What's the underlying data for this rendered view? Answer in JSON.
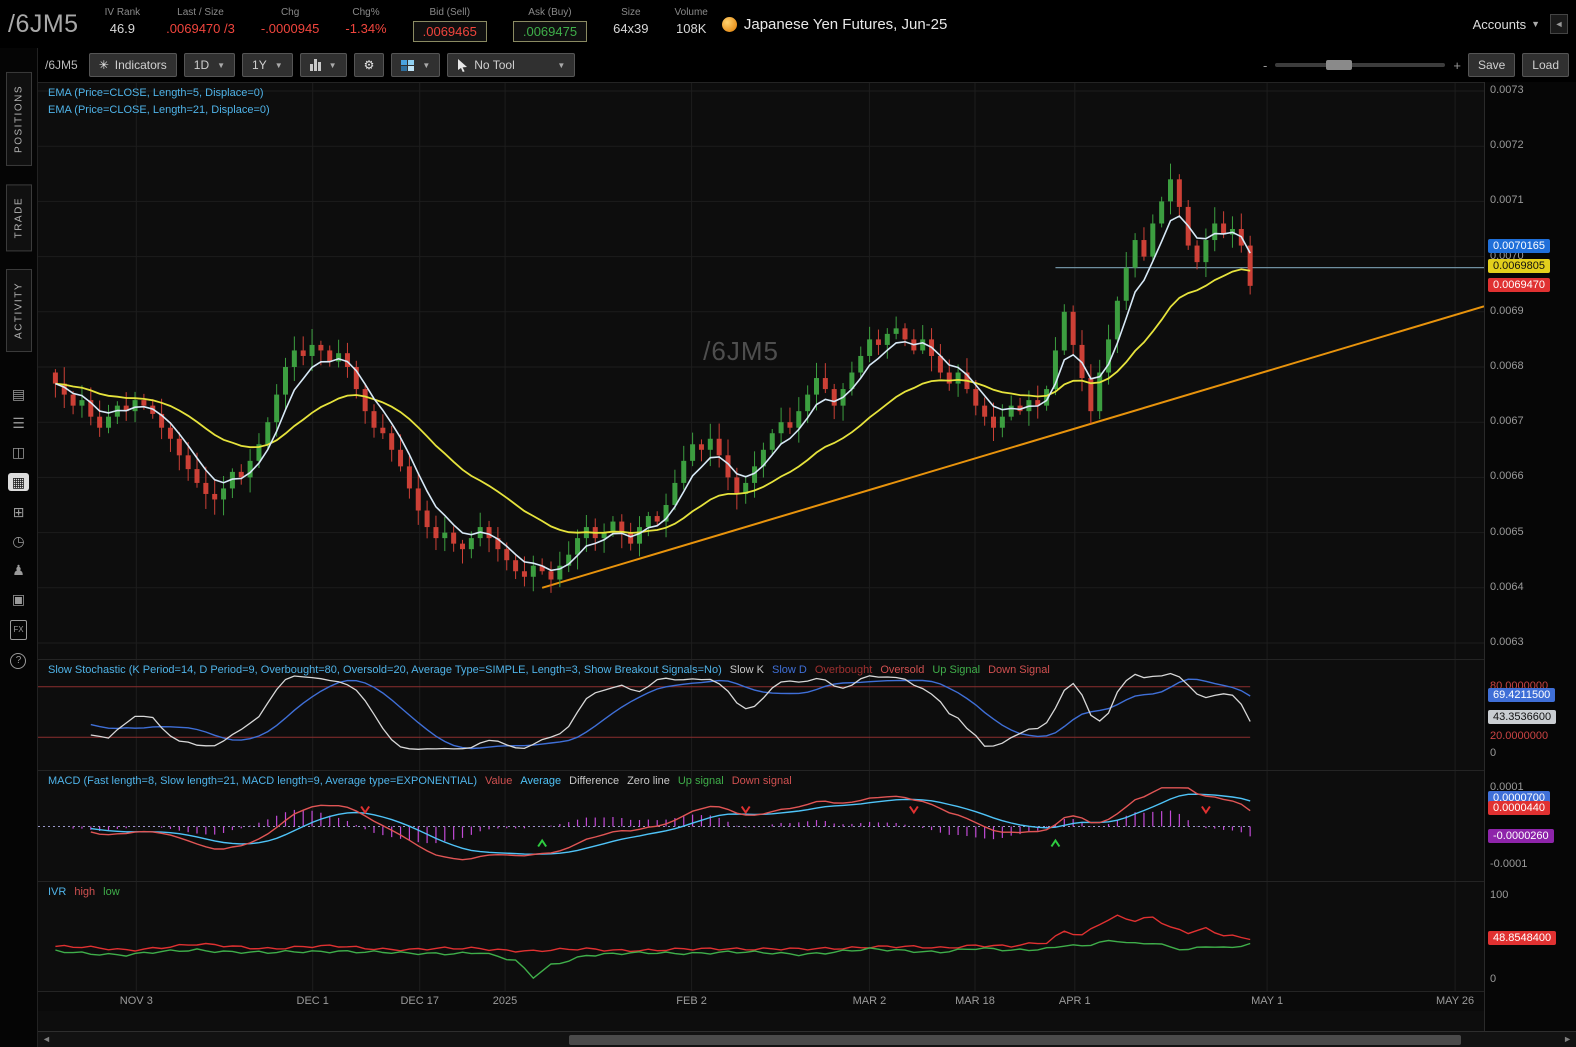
{
  "header": {
    "symbol": "/6JM5",
    "title": "Japanese Yen Futures, Jun-25",
    "accounts_label": "Accounts",
    "fields": [
      {
        "label": "IV Rank",
        "value": "46.9",
        "color": "#d8d8d8",
        "boxed": false
      },
      {
        "label": "Last / Size",
        "value": ".0069470 /3",
        "color": "#f0453d",
        "boxed": false
      },
      {
        "label": "Chg",
        "value": "-.0000945",
        "color": "#f0453d",
        "boxed": false
      },
      {
        "label": "Chg%",
        "value": "-1.34%",
        "color": "#f0453d",
        "boxed": false
      },
      {
        "label": "Bid (Sell)",
        "value": ".0069465",
        "color": "#f0453d",
        "boxed": true
      },
      {
        "label": "Ask (Buy)",
        "value": ".0069475",
        "color": "#3fae4a",
        "boxed": true
      },
      {
        "label": "Size",
        "value": "64x39",
        "color": "#d8d8d8",
        "boxed": false
      },
      {
        "label": "Volume",
        "value": "108K",
        "color": "#d8d8d8",
        "boxed": false
      }
    ]
  },
  "icons": {
    "chevron_down": "▼",
    "collapse_left": "◄",
    "gear": "⚙",
    "indicators": "✳",
    "scroll_left": "◄",
    "scroll_right": "►"
  },
  "sidebar": {
    "tabs": [
      {
        "label": "POSITIONS"
      },
      {
        "label": "TRADE"
      },
      {
        "label": "ACTIVITY"
      }
    ],
    "icons_list": [
      {
        "name": "document-icon",
        "glyph": "▤",
        "active": false
      },
      {
        "name": "list-icon",
        "glyph": "☰",
        "active": false
      },
      {
        "name": "watchlist-icon",
        "glyph": "◫",
        "active": false
      },
      {
        "name": "chart-icon",
        "glyph": "▦",
        "active": true
      },
      {
        "name": "apps-grid-icon",
        "glyph": "⊞",
        "active": false
      },
      {
        "name": "clock-icon",
        "glyph": "◷",
        "active": false
      },
      {
        "name": "people-icon",
        "glyph": "♟",
        "active": false
      },
      {
        "name": "archive-icon",
        "glyph": "▣",
        "active": false
      },
      {
        "name": "fx-icon",
        "glyph": "FX",
        "active": false,
        "fx": true
      },
      {
        "name": "help-icon",
        "glyph": "?",
        "active": false,
        "circle": true
      }
    ]
  },
  "toolbar": {
    "symbol_label": "/6JM5",
    "indicators_label": "Indicators",
    "timeframe": "1D",
    "range": "1Y",
    "tool_label": "No Tool",
    "zoom_minus": "-",
    "zoom_plus": "+",
    "save_label": "Save",
    "load_label": "Load"
  },
  "main_chart": {
    "watermark": "/6JM5"
  },
  "legends": {
    "main": [
      {
        "text": "EMA (Price=CLOSE, Length=5, Displace=0)",
        "color": "#4fb3e8"
      },
      {
        "text": "EMA (Price=CLOSE, Length=21, Displace=0)",
        "color": "#4fb3e8"
      }
    ],
    "stoch": [
      {
        "text": "Slow Stochastic (K Period=14, D Period=9, Overbought=80, Oversold=20, Average Type=SIMPLE, Length=3, Show Breakout Signals=No)",
        "color": "#4fb3e8"
      },
      {
        "text": "Slow K",
        "color": "#c8c8c8"
      },
      {
        "text": "Slow D",
        "color": "#3f6fd7"
      },
      {
        "text": "Overbought",
        "color": "#a03030"
      },
      {
        "text": "Oversold",
        "color": "#d05050"
      },
      {
        "text": "Up Signal",
        "color": "#3fae4a"
      },
      {
        "text": "Down Signal",
        "color": "#d05050"
      }
    ],
    "macd": [
      {
        "text": "MACD (Fast length=8, Slow length=21, MACD length=9, Average type=EXPONENTIAL)",
        "color": "#4fb3e8"
      },
      {
        "text": "Value",
        "color": "#d05050"
      },
      {
        "text": "Average",
        "color": "#4fc3f7"
      },
      {
        "text": "Difference",
        "color": "#c8c8c8"
      },
      {
        "text": "Zero line",
        "color": "#c8c8c8"
      },
      {
        "text": "Up signal",
        "color": "#3fae4a"
      },
      {
        "text": "Down signal",
        "color": "#d05050"
      }
    ],
    "ivr": [
      {
        "text": "IVR",
        "color": "#4fb3e8"
      },
      {
        "text": "high",
        "color": "#d05050"
      },
      {
        "text": "low",
        "color": "#3fae4a"
      }
    ]
  },
  "axis": {
    "main": {
      "ticks": [
        "0.0073",
        "0.0072",
        "0.0071",
        "0.0070",
        "0.0069",
        "0.0068",
        "0.0067",
        "0.0066",
        "0.0065",
        "0.0064",
        "0.0063"
      ],
      "bubbles": [
        {
          "text": "0.0070165",
          "bg": "#1f6fd9",
          "fg": "#ffffff"
        },
        {
          "text": "0.0069805",
          "bg": "#e3cf1c",
          "fg": "#111111"
        },
        {
          "text": "0.0069470",
          "bg": "#e03131",
          "fg": "#ffffff"
        }
      ]
    },
    "stoch": {
      "items": [
        {
          "text": "80.0000000",
          "style": "text",
          "color": "#cc4444"
        },
        {
          "text": "69.4211500",
          "style": "bubble",
          "bg": "#3f6fd7",
          "fg": "#ffffff"
        },
        {
          "text": "43.3536600",
          "style": "bubble",
          "bg": "#c9cdd1",
          "fg": "#111111"
        },
        {
          "text": "20.0000000",
          "style": "text",
          "color": "#cc4444"
        },
        {
          "text": "0",
          "style": "text",
          "color": "#9a9a9a"
        }
      ]
    },
    "macd": {
      "items": [
        {
          "text": "0.0001",
          "style": "text",
          "color": "#9a9a9a"
        },
        {
          "text": "0.0000700",
          "style": "bubble",
          "bg": "#3f6fd7",
          "fg": "#ffffff"
        },
        {
          "text": "0.0000440",
          "style": "bubble",
          "bg": "#e03131",
          "fg": "#ffffff"
        },
        {
          "text": "-0.0000260",
          "style": "bubble",
          "bg": "#8e24aa",
          "fg": "#ffffff"
        },
        {
          "text": "-0.0001",
          "style": "text",
          "color": "#9a9a9a"
        }
      ]
    },
    "ivr": {
      "items": [
        {
          "text": "100",
          "style": "text",
          "color": "#9a9a9a"
        },
        {
          "text": "48.8548400",
          "style": "bubble",
          "bg": "#e03131",
          "fg": "#ffffff"
        },
        {
          "text": "0",
          "style": "text",
          "color": "#9a9a9a"
        }
      ]
    }
  },
  "chart_data": {
    "type": "candlestick",
    "symbol": "/6JM5",
    "ylim": [
      0.0063,
      0.0073
    ],
    "time_ticks": [
      {
        "label": "NOV 3",
        "frac": 0.068
      },
      {
        "label": "DEC 1",
        "frac": 0.19
      },
      {
        "label": "DEC 17",
        "frac": 0.264
      },
      {
        "label": "2025",
        "frac": 0.323
      },
      {
        "label": "FEB 2",
        "frac": 0.452
      },
      {
        "label": "MAR 2",
        "frac": 0.575
      },
      {
        "label": "MAR 18",
        "frac": 0.648
      },
      {
        "label": "APR 1",
        "frac": 0.717
      },
      {
        "label": "MAY 1",
        "frac": 0.85
      },
      {
        "label": "MAY 26",
        "frac": 0.98
      }
    ],
    "closes": [
      0.00677,
      0.00675,
      0.00673,
      0.00674,
      0.00671,
      0.00669,
      0.00671,
      0.00673,
      0.00672,
      0.00674,
      0.00673,
      0.006715,
      0.00669,
      0.00667,
      0.00664,
      0.006615,
      0.00659,
      0.00657,
      0.00656,
      0.00658,
      0.00661,
      0.0066,
      0.00663,
      0.00666,
      0.0067,
      0.00675,
      0.0068,
      0.00683,
      0.00682,
      0.00684,
      0.00683,
      0.00681,
      0.006825,
      0.0068,
      0.00676,
      0.00672,
      0.00669,
      0.00668,
      0.00665,
      0.00662,
      0.00658,
      0.00654,
      0.00651,
      0.00649,
      0.0065,
      0.00648,
      0.00647,
      0.00649,
      0.00651,
      0.00649,
      0.00647,
      0.00645,
      0.00643,
      0.00642,
      0.00644,
      0.00643,
      0.006415,
      0.00644,
      0.00646,
      0.00649,
      0.00651,
      0.00649,
      0.0065,
      0.00652,
      0.0065,
      0.00648,
      0.00651,
      0.00653,
      0.00652,
      0.00655,
      0.00659,
      0.00663,
      0.00666,
      0.00665,
      0.00667,
      0.00664,
      0.0066,
      0.00657,
      0.00659,
      0.00662,
      0.00665,
      0.00668,
      0.0067,
      0.00669,
      0.00672,
      0.00675,
      0.00678,
      0.00676,
      0.00673,
      0.00676,
      0.00679,
      0.00682,
      0.00685,
      0.00684,
      0.00686,
      0.00687,
      0.00685,
      0.00683,
      0.00685,
      0.00682,
      0.00679,
      0.00677,
      0.00679,
      0.00676,
      0.00673,
      0.00671,
      0.00669,
      0.00671,
      0.00673,
      0.00672,
      0.00674,
      0.00673,
      0.00676,
      0.00683,
      0.0069,
      0.00684,
      0.00678,
      0.00672,
      0.00679,
      0.00685,
      0.00692,
      0.00698,
      0.00703,
      0.007,
      0.00706,
      0.0071,
      0.00714,
      0.00709,
      0.00702,
      0.00699,
      0.00703,
      0.00706,
      0.00704,
      0.00705,
      0.00702,
      0.006947
    ],
    "trendline": {
      "i1": 55,
      "p1": 0.0064,
      "p2": 0.00691
    },
    "hline": {
      "from_i": 113,
      "price": 0.00698
    },
    "stoch": {
      "overbought": 80,
      "oversold": 20,
      "k_period": 14,
      "smooth": 3,
      "d_period": 9,
      "ylim": [
        0,
        100
      ]
    },
    "macd": {
      "fast": 8,
      "slow": 21,
      "signal": 9,
      "ylim": [
        -0.0001,
        0.0001
      ]
    },
    "ivr": {
      "ylim": [
        0,
        100
      ],
      "high_anchors": [
        [
          0,
          40
        ],
        [
          8,
          36
        ],
        [
          16,
          42
        ],
        [
          24,
          38
        ],
        [
          32,
          40
        ],
        [
          40,
          36
        ],
        [
          48,
          38
        ],
        [
          54,
          34
        ],
        [
          60,
          37
        ],
        [
          68,
          35
        ],
        [
          76,
          38
        ],
        [
          84,
          36
        ],
        [
          92,
          40
        ],
        [
          100,
          38
        ],
        [
          104,
          42
        ],
        [
          108,
          40
        ],
        [
          112,
          44
        ],
        [
          114,
          58
        ],
        [
          116,
          54
        ],
        [
          118,
          68
        ],
        [
          120,
          76
        ],
        [
          122,
          70
        ],
        [
          124,
          74
        ],
        [
          126,
          62
        ],
        [
          128,
          57
        ],
        [
          130,
          62
        ],
        [
          132,
          54
        ],
        [
          135,
          49
        ]
      ],
      "low_anchors": [
        [
          0,
          34
        ],
        [
          8,
          30
        ],
        [
          16,
          36
        ],
        [
          24,
          32
        ],
        [
          32,
          35
        ],
        [
          40,
          31
        ],
        [
          48,
          33
        ],
        [
          52,
          22
        ],
        [
          54,
          3
        ],
        [
          56,
          18
        ],
        [
          60,
          30
        ],
        [
          68,
          32
        ],
        [
          76,
          33
        ],
        [
          84,
          31
        ],
        [
          92,
          36
        ],
        [
          100,
          34
        ],
        [
          104,
          37
        ],
        [
          108,
          35
        ],
        [
          112,
          38
        ],
        [
          114,
          42
        ],
        [
          116,
          40
        ],
        [
          118,
          44
        ],
        [
          120,
          46
        ],
        [
          122,
          43
        ],
        [
          124,
          45
        ],
        [
          126,
          40
        ],
        [
          128,
          36
        ],
        [
          130,
          40
        ],
        [
          132,
          37
        ],
        [
          135,
          42
        ]
      ]
    },
    "colors": {
      "up": "#3c9e40",
      "down": "#cc4036",
      "ema_fast": "#d7e9f7",
      "ema_slow": "#e6e33c",
      "trendline": "#e8930c",
      "hline": "#6f8fa0",
      "stoch_k": "#d8d8d8",
      "stoch_d": "#3f6fd7",
      "stoch_bands": "#8b2f2f",
      "macd_value": "#e05555",
      "macd_avg": "#4fc3f7",
      "macd_hist": "#c24ad6",
      "macd_zero": "#9898c8",
      "ivr_high": "#e03131",
      "ivr_low": "#3fae4a",
      "up_signal": "#2ecc40",
      "down_signal": "#e03131",
      "grid": "#1d1d1d"
    }
  }
}
